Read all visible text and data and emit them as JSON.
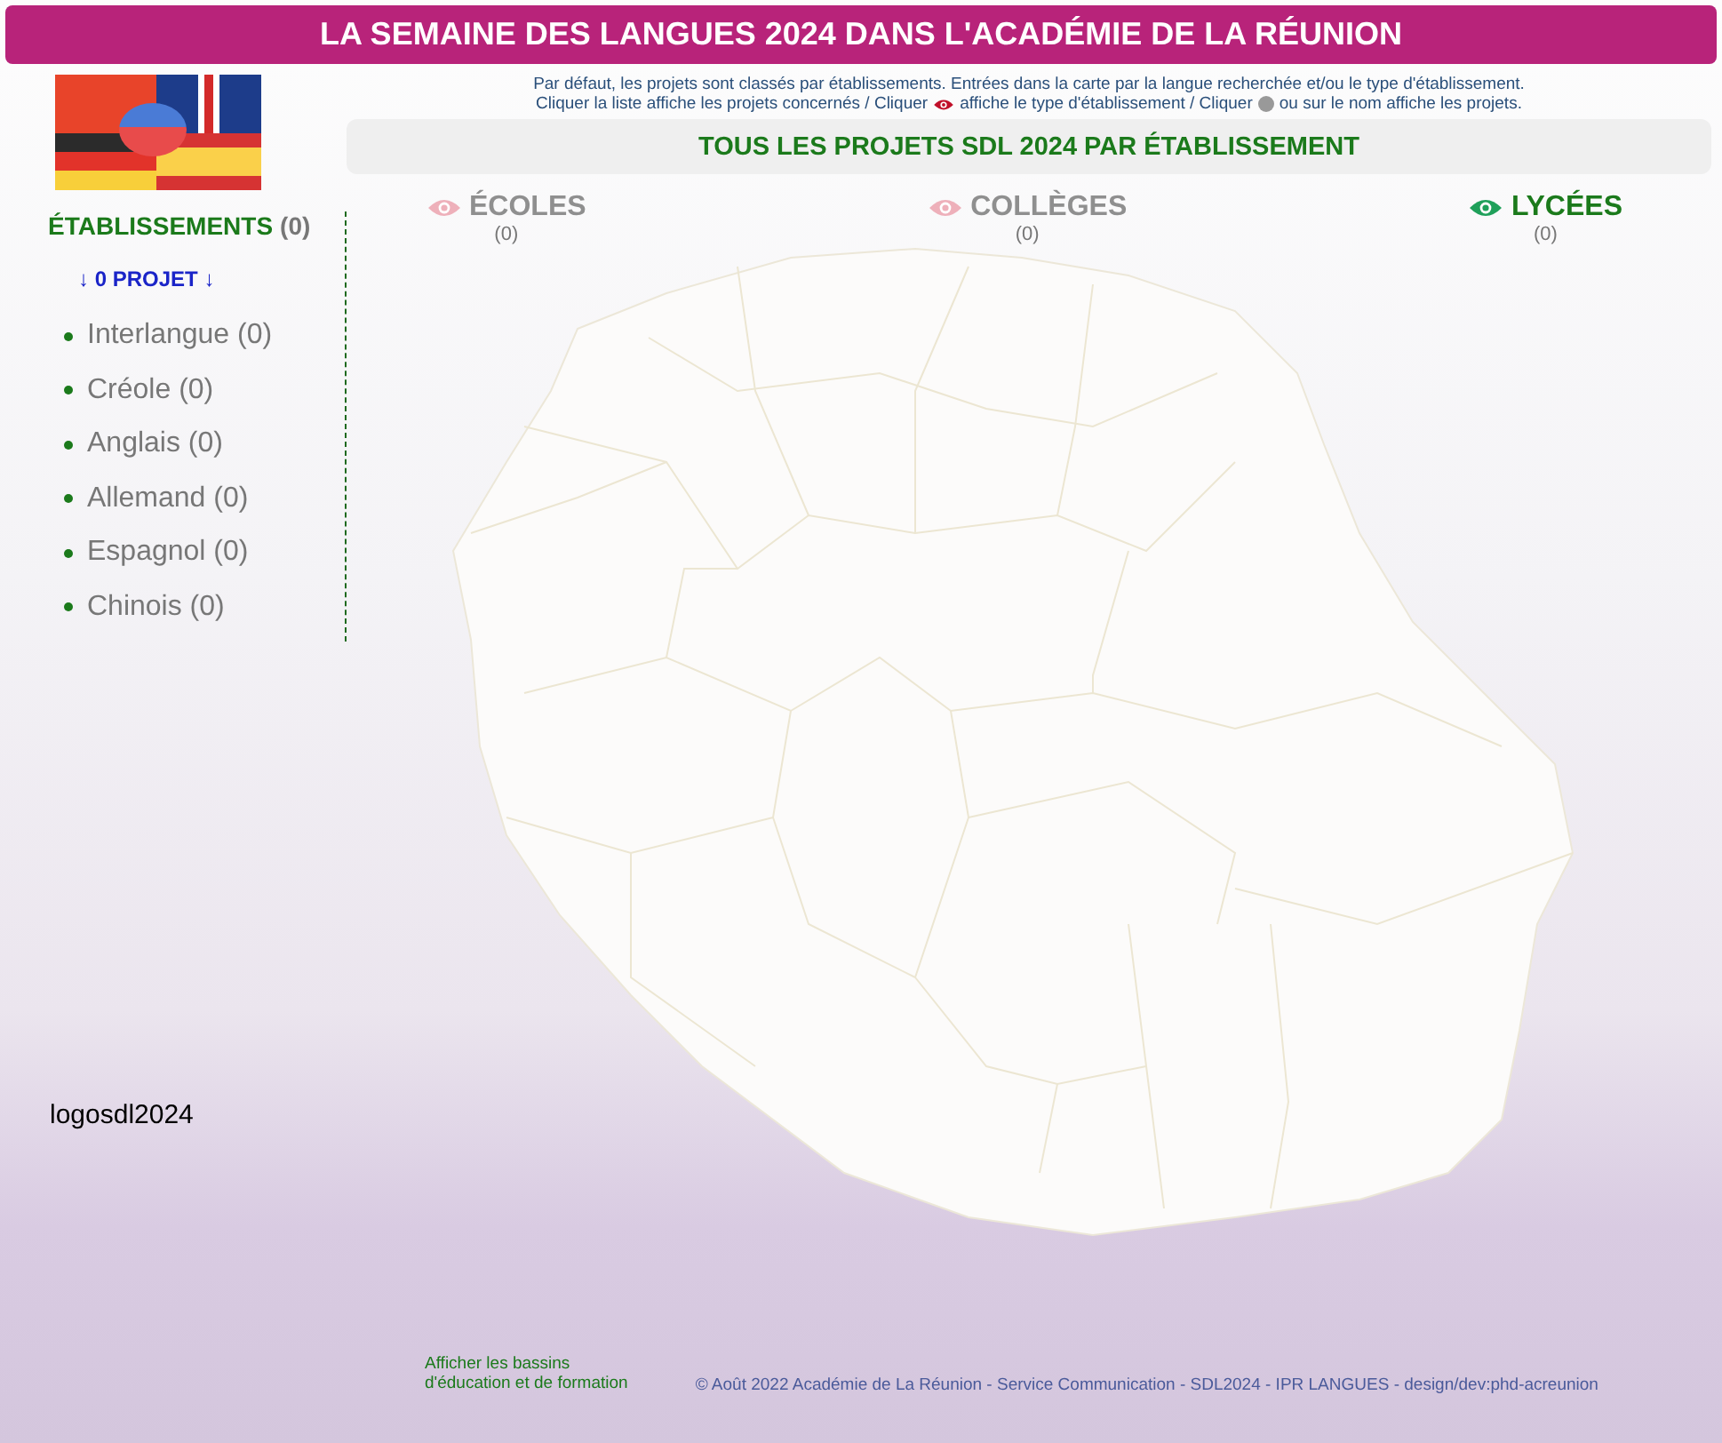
{
  "header": {
    "title": "LA SEMAINE DES LANGUES 2024 DANS L'ACADÉMIE DE LA RÉUNION"
  },
  "help": {
    "line_1": "Par défaut, les projets sont classés par établissements. Entrées dans la carte par la langue recherchée et/ou le type d'établissement.",
    "line_2": [
      {
        "kind": "text",
        "text": "Cliquer la liste affiche les projets concernés / Cliquer"
      },
      {
        "kind": "eye"
      },
      {
        "kind": "text",
        "text": "affiche le type d'établissement / Cliquer"
      },
      {
        "kind": "dot"
      },
      {
        "kind": "text",
        "text": "ou sur le nom affiche les projets."
      }
    ]
  },
  "banner": "TOUS LES PROJETS SDL 2024 PAR ÉTABLISSEMENT",
  "sidebar": {
    "heading": "ÉTABLISSEMENTS",
    "heading_count": "(0)",
    "projects": "↓ 0 PROJET ↓",
    "languages": [
      {
        "label": "Interlangue (0)"
      },
      {
        "label": "Créole (0)"
      },
      {
        "label": "Anglais (0)"
      },
      {
        "label": "Allemand (0)"
      },
      {
        "label": "Espagnol (0)"
      },
      {
        "label": "Chinois (0)"
      }
    ],
    "logo_alt": "logosdl2024"
  },
  "types": [
    {
      "label": "ÉCOLES",
      "count": "(0)",
      "selected": false
    },
    {
      "label": "COLLÈGES",
      "count": "(0)",
      "selected": false
    },
    {
      "label": "LYCÉES",
      "count": "(0)",
      "selected": true
    }
  ],
  "footer": {
    "link": [
      "Afficher les bassins",
      "d'éducation et de formation"
    ],
    "credits": "© Août 2022 Académie de La Réunion - Service Communication - SDL2024 - IPR LANGUES - design/dev:phd-acreunion"
  }
}
